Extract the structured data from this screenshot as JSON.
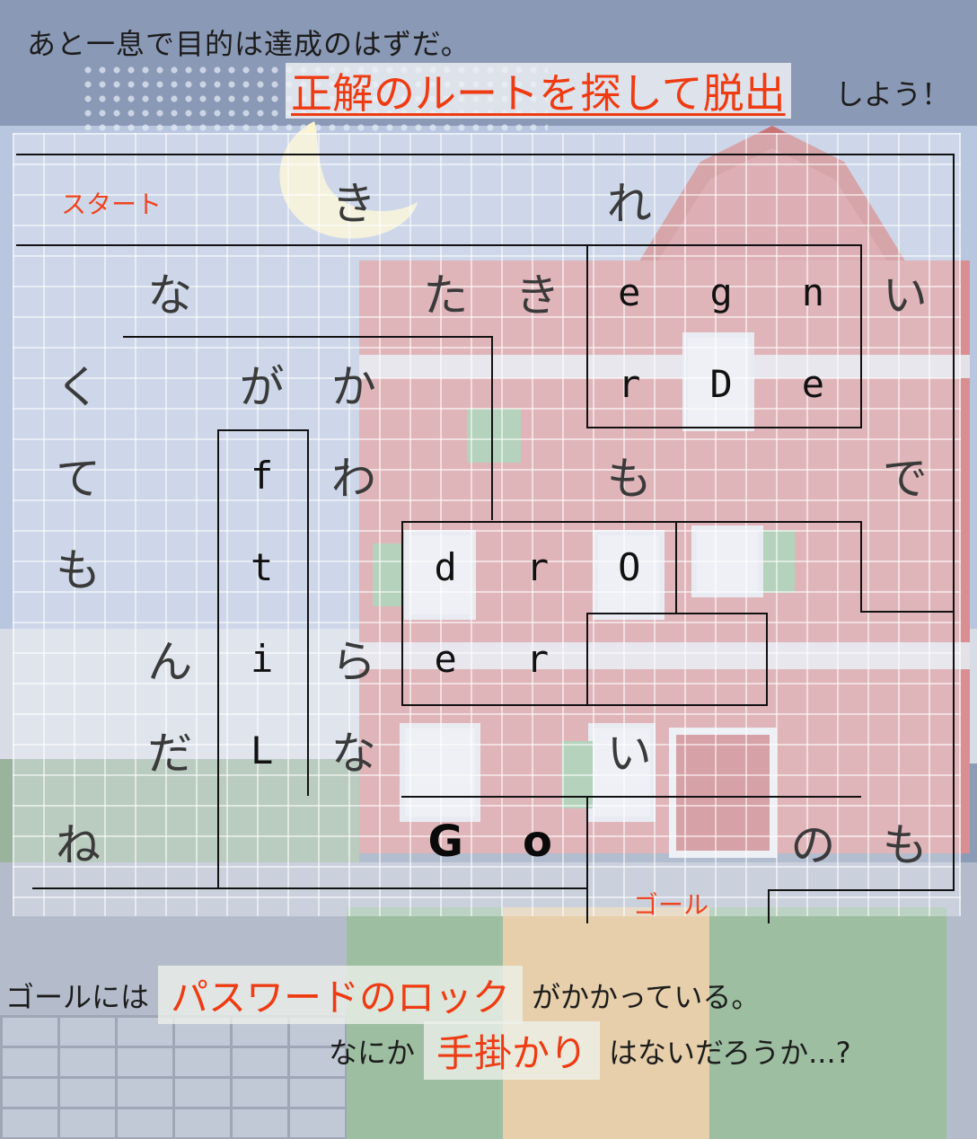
{
  "header": {
    "intro": "あと一息で目的は達成のはずだ。",
    "highlight": "正解のルートを探して脱出",
    "tail": "しよう！"
  },
  "maze": {
    "start_label": "スタート",
    "goal_label": "ゴール",
    "rows": [
      [
        "",
        "",
        "",
        "き",
        "",
        "",
        "れ",
        "",
        "",
        ""
      ],
      [
        "",
        "な",
        "",
        "",
        "た",
        "き",
        "e",
        "g",
        "n",
        "い"
      ],
      [
        "く",
        "",
        "が",
        "か",
        "",
        "",
        "r",
        "D",
        "e",
        ""
      ],
      [
        "て",
        "",
        "f",
        "わ",
        "",
        "",
        "も",
        "",
        "",
        "で"
      ],
      [
        "も",
        "",
        "t",
        "",
        "d",
        "r",
        "O",
        "",
        "",
        ""
      ],
      [
        "",
        "ん",
        "i",
        "ら",
        "e",
        "r",
        "",
        "",
        "",
        ""
      ],
      [
        "",
        "だ",
        "L",
        "な",
        "",
        "",
        "い",
        "",
        "",
        ""
      ],
      [
        "ね",
        "",
        "",
        "",
        "G",
        "o",
        "",
        "",
        "の",
        "も"
      ]
    ]
  },
  "footer": {
    "line1_pre": "ゴールには",
    "line1_highlight": "パスワードのロック",
    "line1_post": "がかかっている。",
    "line2_pre": "なにか",
    "line2_highlight": "手掛かり",
    "line2_post": "はないだろうか...?"
  },
  "colors": {
    "accent": "#ef3b12",
    "wall": "#111111"
  }
}
